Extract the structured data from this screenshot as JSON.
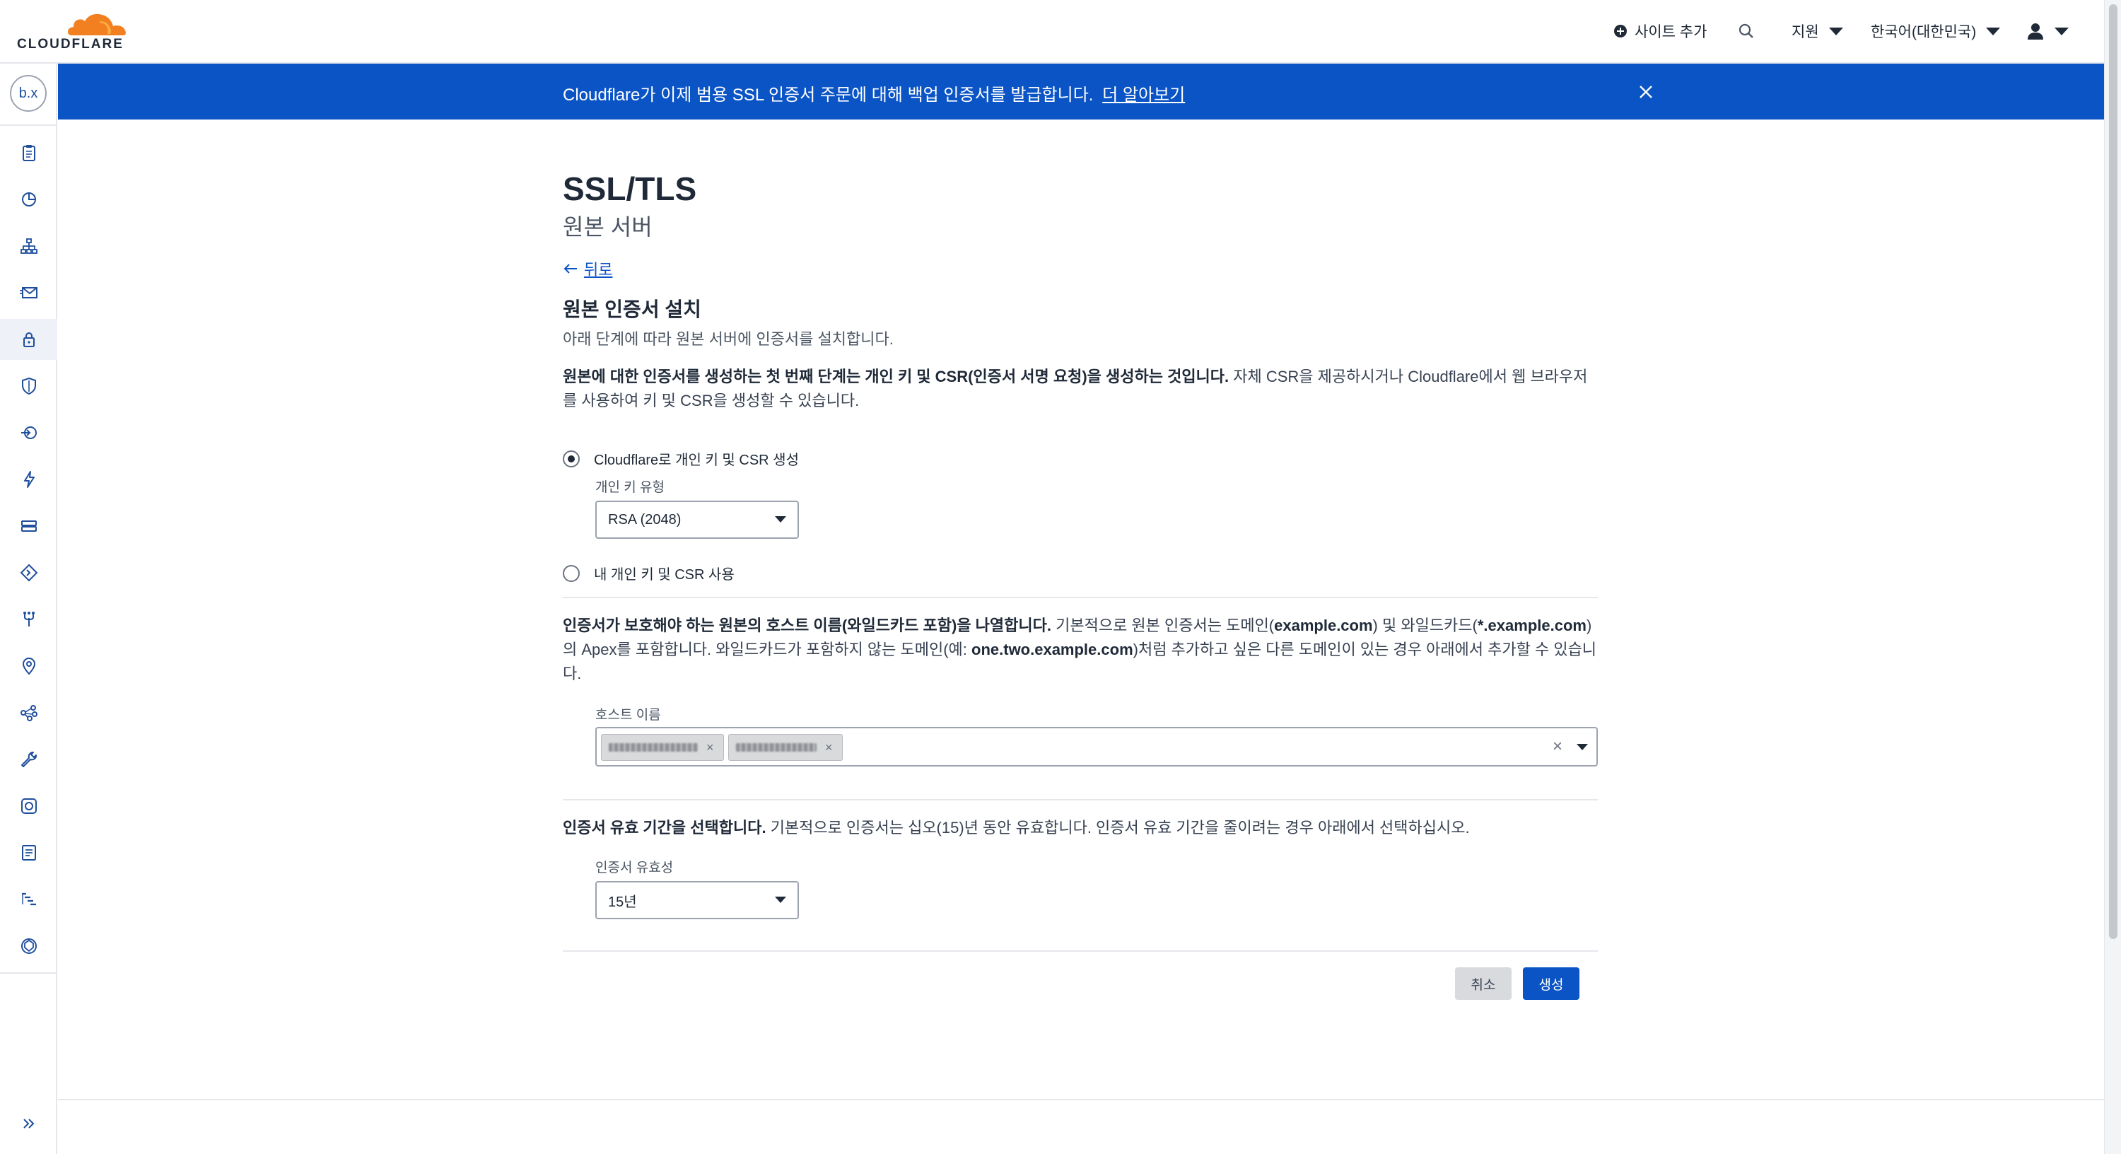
{
  "app": {
    "brand": "CLOUDFLARE",
    "brand_color": "#f38020"
  },
  "topnav": {
    "add_site": "사이트 추가",
    "support": "지원",
    "language": "한국어(대한민국)"
  },
  "sidebar": {
    "account_badge": "b.x",
    "items": [
      {
        "icon": "clipboard-icon"
      },
      {
        "icon": "pie-chart-icon"
      },
      {
        "icon": "network-tree-icon"
      },
      {
        "icon": "email-icon"
      },
      {
        "icon": "lock-icon",
        "active": true
      },
      {
        "icon": "shield-icon"
      },
      {
        "icon": "traffic-icon"
      },
      {
        "icon": "lightning-icon"
      },
      {
        "icon": "caching-icon"
      },
      {
        "icon": "rules-icon"
      },
      {
        "icon": "network-icon"
      },
      {
        "icon": "location-pin-icon"
      },
      {
        "icon": "workers-icon"
      },
      {
        "icon": "wrench-icon"
      },
      {
        "icon": "scrape-shield-icon"
      },
      {
        "icon": "document-icon"
      },
      {
        "icon": "logs-icon"
      },
      {
        "icon": "zero-trust-icon"
      }
    ],
    "expand_icon": "double-chevron-right-icon"
  },
  "banner": {
    "text": "Cloudflare가 이제 범용 SSL 인증서 주문에 대해 백업 인증서를 발급합니다.",
    "link": "더 알아보기"
  },
  "page": {
    "title": "SSL/TLS",
    "subtitle": "원본 서버",
    "back": "뒤로"
  },
  "install": {
    "title": "원본 인증서 설치",
    "description": "아래 단계에 따라 원본 서버에 인증서를 설치합니다.",
    "intro_bold": "원본에 대한 인증서를 생성하는 첫 번째 단계는 개인 키 및 CSR(인증서 서명 요청)을 생성하는 것입니다.",
    "intro_rest": " 자체 CSR을 제공하시거나 Cloudflare에서 웹 브라우저를 사용하여 키 및 CSR을 생성할 수 있습니다."
  },
  "key_options": {
    "option_cloudflare": "Cloudflare로 개인 키 및 CSR 생성",
    "key_type_label": "개인 키 유형",
    "key_type_value": "RSA (2048)",
    "option_own": "내 개인 키 및 CSR 사용"
  },
  "hostnames": {
    "intro_bold": "인증서가 보호해야 하는 원본의 호스트 이름(와일드카드 포함)을 나열합니다.",
    "intro_p1": " 기본적으로 원본 인증서는 도메인(",
    "example_domain": "example.com",
    "intro_p2": ") 및 와일드카드(",
    "example_wildcard": "*.example.com",
    "intro_p3": ")의 Apex를 포함합니다. 와일드카드가 포함하지 않는 도메인(예: ",
    "example_sub": "one.two.example.com",
    "intro_p4": ")처럼 추가하고 싶은 다른 도메인이 있는 경우 아래에서 추가할 수 있습니다.",
    "label": "호스트 이름",
    "chip_remove": "×",
    "clear": "×"
  },
  "validity": {
    "intro_bold": "인증서 유효 기간을 선택합니다.",
    "intro_rest": " 기본적으로 인증서는 십오(15)년 동안 유효합니다. 인증서 유효 기간을 줄이려는 경우 아래에서 선택하십시오.",
    "label": "인증서 유효성",
    "value": "15년"
  },
  "actions": {
    "cancel": "취소",
    "create": "생성"
  },
  "colors": {
    "accent": "#0a54c6",
    "brand_orange": "#f38020"
  }
}
